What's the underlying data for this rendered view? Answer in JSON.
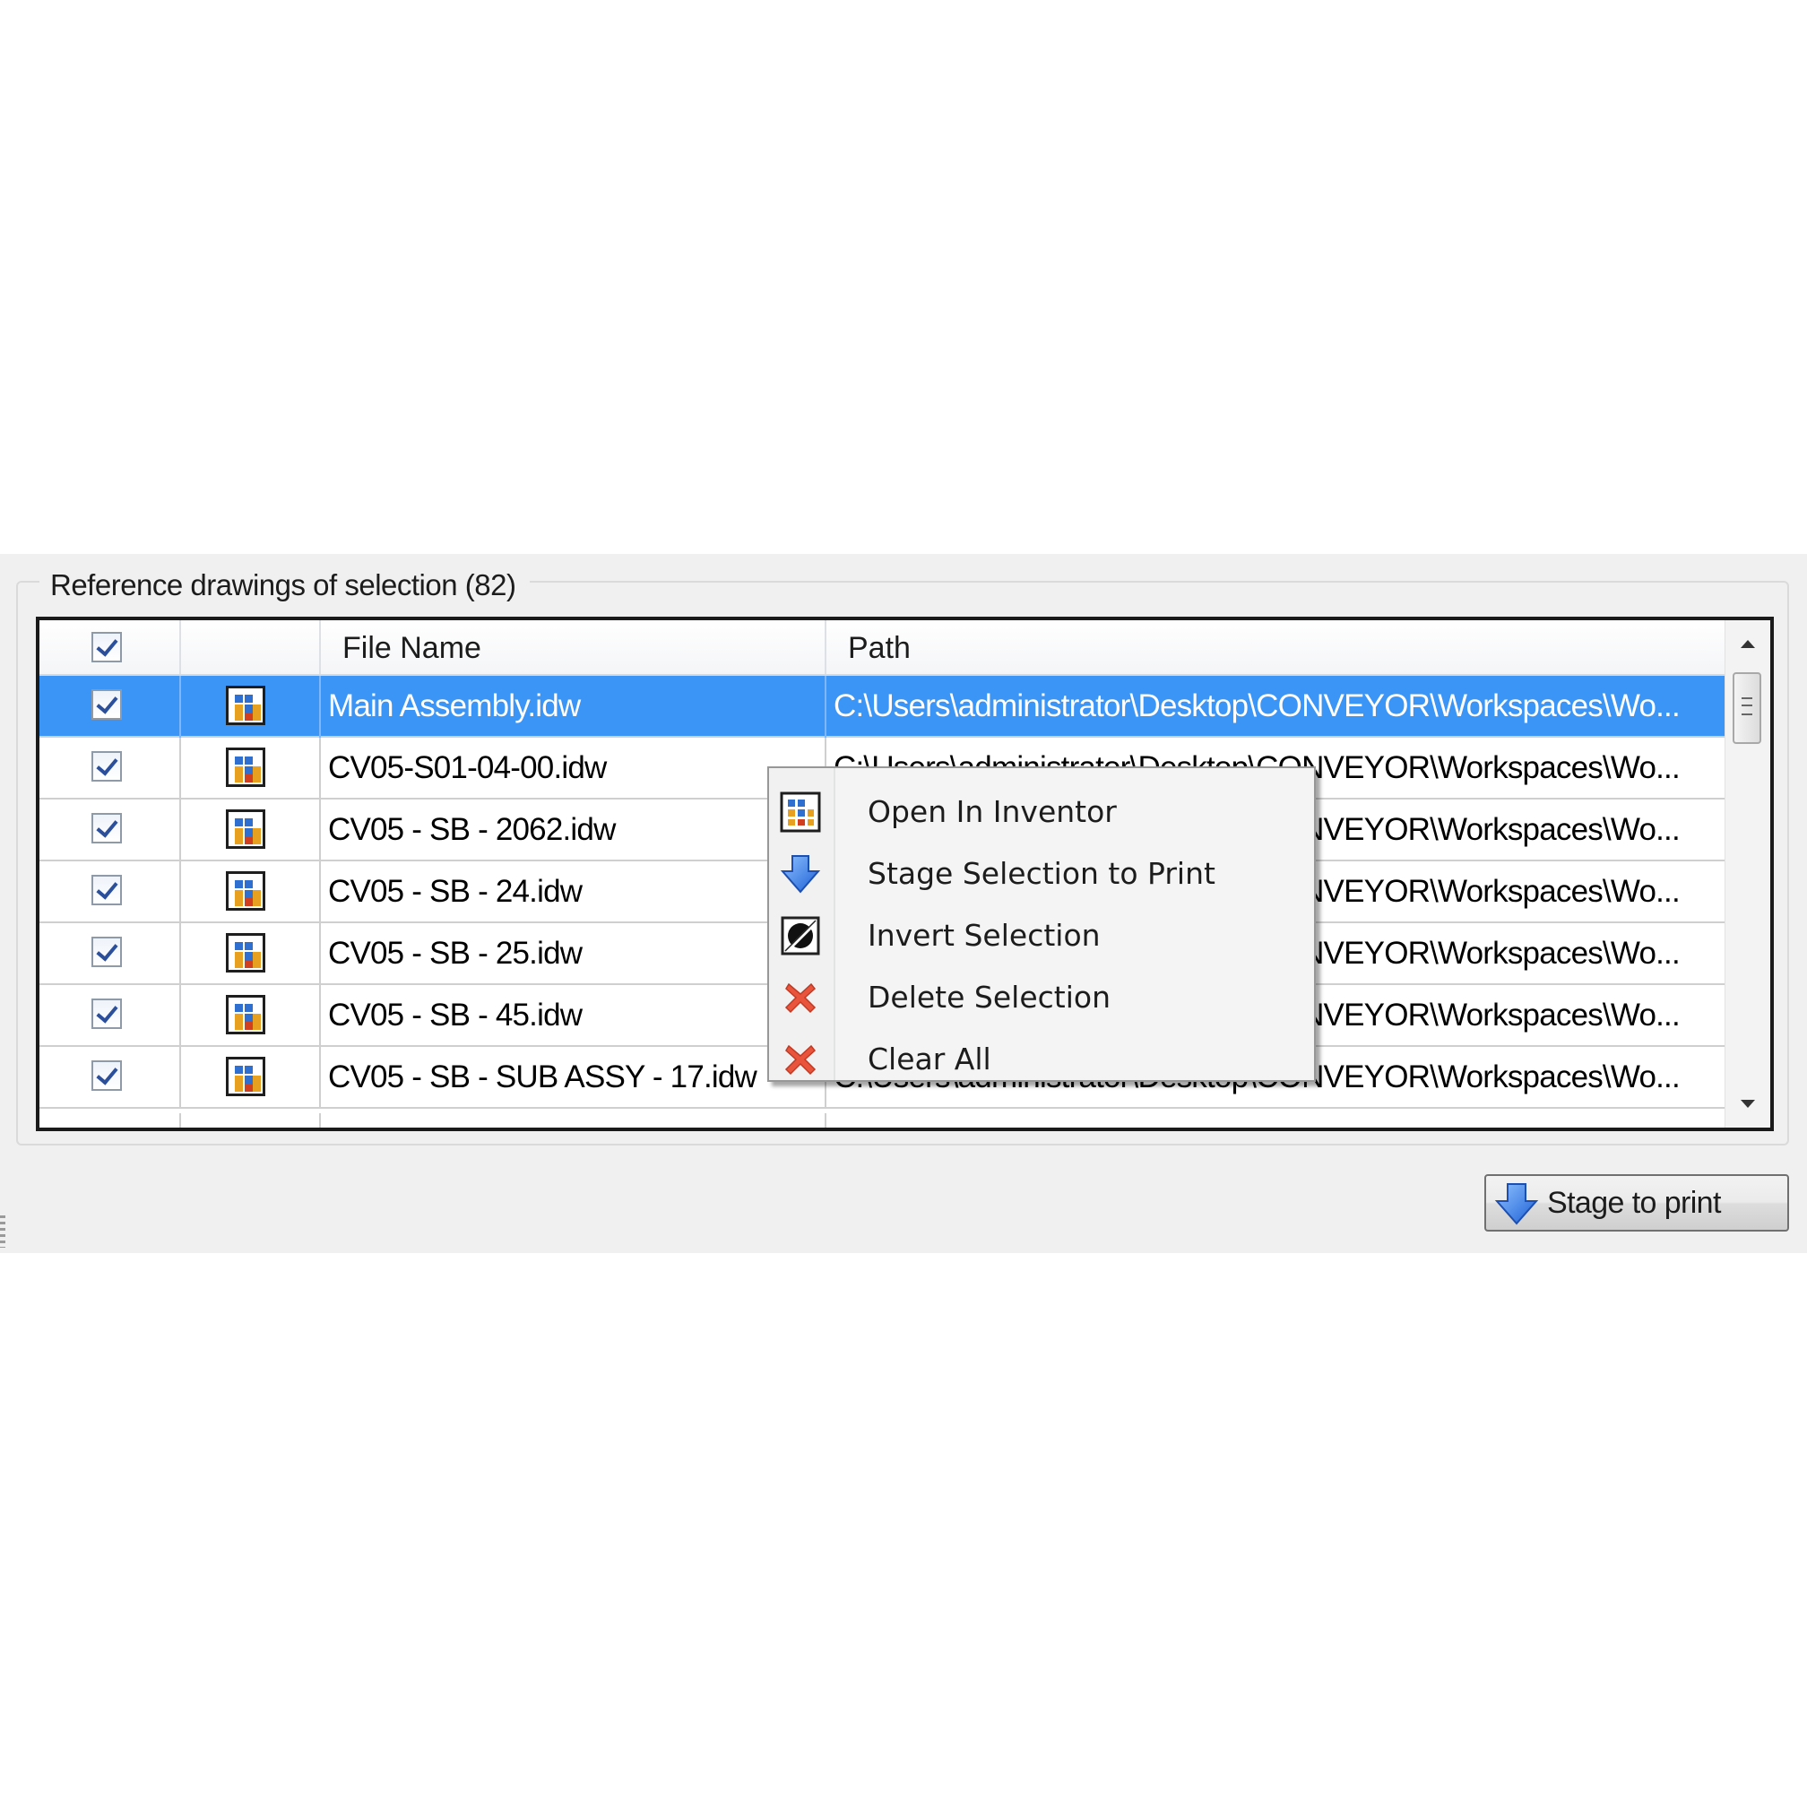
{
  "group": {
    "title": "Reference drawings of selection (82)"
  },
  "grid": {
    "columns": [
      "",
      "",
      "File Name",
      "Path"
    ],
    "rows": [
      {
        "checked": true,
        "file_name": "Main Assembly.idw",
        "path": "C:\\Users\\administrator\\Desktop\\CONVEYOR\\Workspaces\\Wo...",
        "selected": true
      },
      {
        "checked": true,
        "file_name": "CV05-S01-04-00.idw",
        "path": "C:\\Users\\administrator\\Desktop\\CONVEYOR\\Workspaces\\Wo...",
        "selected": false
      },
      {
        "checked": true,
        "file_name": "CV05 - SB - 2062.idw",
        "path": "C:\\Users\\administrator\\Desktop\\CONVEYOR\\Workspaces\\Wo...",
        "selected": false
      },
      {
        "checked": true,
        "file_name": "CV05 - SB - 24.idw",
        "path": "C:\\Users\\administrator\\Desktop\\CONVEYOR\\Workspaces\\Wo...",
        "selected": false
      },
      {
        "checked": true,
        "file_name": "CV05 - SB - 25.idw",
        "path": "C:\\Users\\administrator\\Desktop\\CONVEYOR\\Workspaces\\Wo...",
        "selected": false
      },
      {
        "checked": true,
        "file_name": "CV05 - SB - 45.idw",
        "path": "C:\\Users\\administrator\\Desktop\\CONVEYOR\\Workspaces\\Wo...",
        "selected": false
      },
      {
        "checked": true,
        "file_name": "CV05 - SB - SUB ASSY - 17.idw",
        "path": "C:\\Users\\administrator\\Desktop\\CONVEYOR\\Workspaces\\Wo...",
        "selected": false
      }
    ]
  },
  "context_menu": {
    "items": [
      {
        "label": "Open In Inventor",
        "icon": "inventor-drawing-icon"
      },
      {
        "label": "Stage Selection to Print",
        "icon": "blue-down-arrow-icon"
      },
      {
        "label": "Invert Selection",
        "icon": "invert-selection-icon"
      },
      {
        "label": "Delete Selection",
        "icon": "red-x-icon"
      },
      {
        "label": "Clear All",
        "icon": "red-x-icon"
      }
    ]
  },
  "buttons": {
    "stage_to_print": "Stage to print"
  },
  "colors": {
    "selection": "#3b95f6",
    "panel": "#f0f0f0",
    "menu_bg": "#f4f4f4"
  }
}
